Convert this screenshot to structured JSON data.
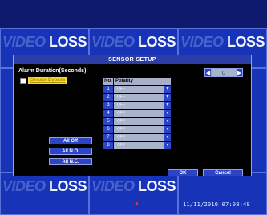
{
  "tiles": {
    "t1_dim": "VIDEO",
    "t1_bright": "LOSS",
    "t2_dim": "VIDEO",
    "t2_bright": "LOSS",
    "t3_dim": "VIDEO",
    "t3_bright": "LOSS",
    "t4_dim": "VIDEO",
    "t4_bright": "LOSS",
    "t5_dim": "VIDEO",
    "t5_bright": "LOSS"
  },
  "timestamp": "11/11/2010 07:08:48",
  "dialog": {
    "title": "SENSOR SETUP",
    "alarm_label": "Alarm Duration(Seconds):",
    "alarm_value": "0",
    "spin_left": "◀",
    "spin_right": "▶",
    "checkbox_label": "Sensor Bypass",
    "table": {
      "col_no": "No.",
      "col_polarity": "Polarity",
      "rows": [
        {
          "no": "1",
          "polarity": "OFF"
        },
        {
          "no": "2",
          "polarity": "OFF"
        },
        {
          "no": "3",
          "polarity": "OFF"
        },
        {
          "no": "4",
          "polarity": "OFF"
        },
        {
          "no": "5",
          "polarity": "OFF"
        },
        {
          "no": "6",
          "polarity": "OFF"
        },
        {
          "no": "7",
          "polarity": "OFF"
        },
        {
          "no": "8",
          "polarity": "OFF"
        }
      ]
    },
    "all_off": "All Off",
    "all_no": "All N.O.",
    "all_nc": "All N.C.",
    "ok": "OK",
    "cancel": "Cancel"
  },
  "icons": {
    "dropdown": "chevron-down-icon",
    "recording": "recording-icon"
  },
  "colors": {
    "tile_blue": "#1733b8",
    "button_blue": "#2d45c4",
    "highlight_yellow": "#f2de2a"
  }
}
